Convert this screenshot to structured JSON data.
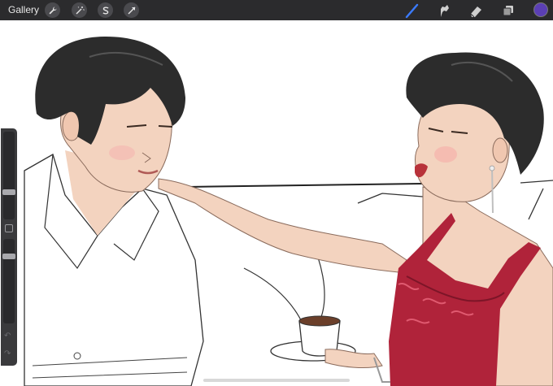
{
  "toolbar": {
    "gallery_label": "Gallery",
    "left_tools": [
      "wrench-icon",
      "magic-wand-icon",
      "selection-icon",
      "transform-icon"
    ],
    "right_tools": [
      "brush-icon",
      "smudge-icon",
      "eraser-icon",
      "layers-icon"
    ],
    "active_tool": "brush-icon",
    "accent_color": "#3b7bff",
    "current_color": "#5b3fb5"
  },
  "sidebar": {
    "brush_size_level": 0.3,
    "opacity_level": 0.2
  },
  "colors": {
    "topbar": "#2b2b2d",
    "dress": "#b0233a",
    "skin": "#f3d3bf",
    "hair": "#2c2c2c"
  }
}
